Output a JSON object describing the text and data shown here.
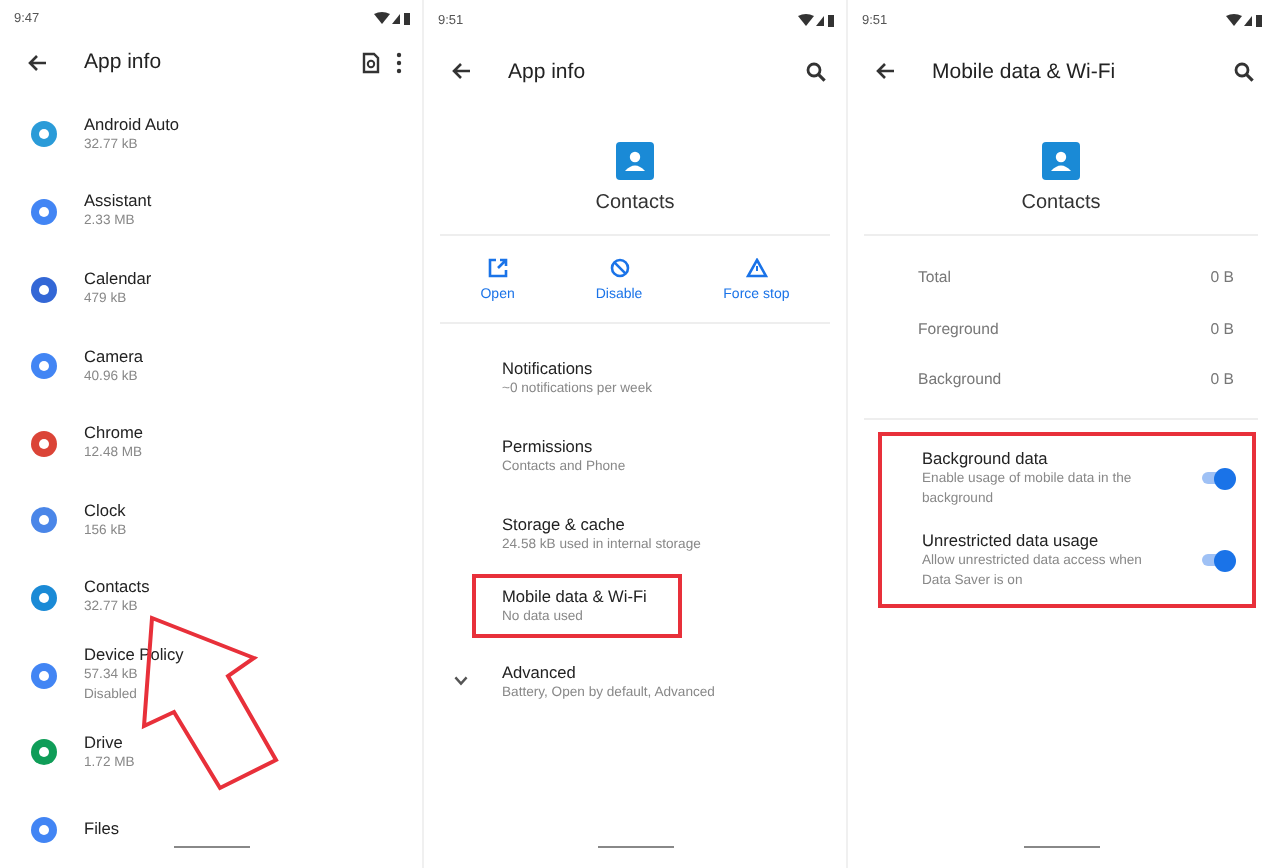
{
  "app_list_screen": {
    "status_time": "9:47",
    "title": "App info",
    "apps": [
      {
        "name": "Android Auto",
        "size": "32.77 kB",
        "color": "#2a9bd8"
      },
      {
        "name": "Assistant",
        "size": "2.33 MB",
        "color": "#4285f4"
      },
      {
        "name": "Calendar",
        "size": "479 kB",
        "color": "#3367d6"
      },
      {
        "name": "Camera",
        "size": "40.96 kB",
        "color": "#4285f4"
      },
      {
        "name": "Chrome",
        "size": "12.48 MB",
        "color": "#db4437"
      },
      {
        "name": "Clock",
        "size": "156 kB",
        "color": "#4a86e8"
      },
      {
        "name": "Contacts",
        "size": "32.77 kB",
        "color": "#1a8ad6"
      },
      {
        "name": "Device Policy",
        "size": "57.34 kB",
        "status": "Disabled",
        "color": "#4285f4"
      },
      {
        "name": "Drive",
        "size": "1.72 MB",
        "color": "#0f9d58"
      },
      {
        "name": "Files",
        "color": "#4285f4"
      }
    ]
  },
  "app_info_screen": {
    "status_time": "9:51",
    "title": "App info",
    "app_name": "Contacts",
    "actions": [
      {
        "label": "Open",
        "kind": "open"
      },
      {
        "label": "Disable",
        "kind": "disable"
      },
      {
        "label": "Force stop",
        "kind": "stop"
      }
    ],
    "settings": [
      {
        "title": "Notifications",
        "subtitle": "~0 notifications per week",
        "highlighted": false,
        "expandable": false
      },
      {
        "title": "Permissions",
        "subtitle": "Contacts and Phone",
        "highlighted": false,
        "expandable": false
      },
      {
        "title": "Storage & cache",
        "subtitle": "24.58 kB used in internal storage",
        "highlighted": false,
        "expandable": false
      },
      {
        "title": "Mobile data & Wi-Fi",
        "subtitle": "No data used",
        "highlighted": true,
        "expandable": false
      },
      {
        "title": "Advanced",
        "subtitle": "Battery, Open by default, Advanced",
        "highlighted": false,
        "expandable": true
      }
    ]
  },
  "data_usage_screen": {
    "status_time": "9:51",
    "title": "Mobile data & Wi-Fi",
    "app_name": "Contacts",
    "usage": [
      {
        "label": "Total",
        "value": "0 B"
      },
      {
        "label": "Foreground",
        "value": "0 B"
      },
      {
        "label": "Background",
        "value": "0 B"
      }
    ],
    "toggles_highlighted": true,
    "toggles": [
      {
        "title": "Background data",
        "subtitle": "Enable usage of mobile data in the background",
        "on": true
      },
      {
        "title": "Unrestricted data usage",
        "subtitle": "Allow unrestricted data access when Data Saver is on",
        "on": true
      }
    ]
  }
}
